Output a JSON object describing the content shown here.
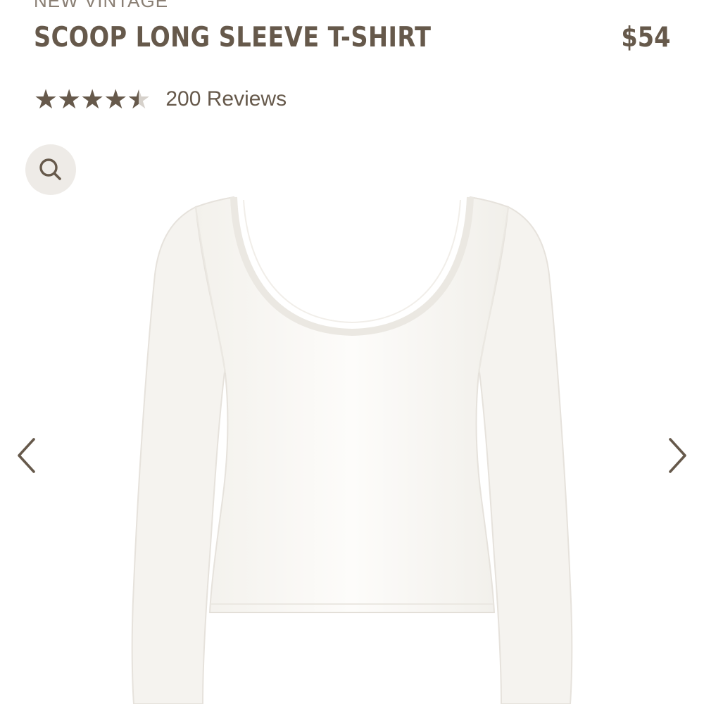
{
  "product": {
    "collection": "NEW VINTAGE",
    "title": "SCOOP LONG SLEEVE T-SHIRT",
    "price": "$54",
    "rating": 4.5,
    "rating_max": 5,
    "reviews_label": "200 Reviews"
  },
  "gallery": {
    "zoom_icon": "search-icon",
    "prev_icon": "chevron-left-icon",
    "next_icon": "chevron-right-icon",
    "image": "white scoop neck long sleeve t-shirt"
  },
  "colors": {
    "brand_text": "#66594b",
    "zoom_bg": "#eeebe7",
    "shirt": "#fbfaf7"
  }
}
